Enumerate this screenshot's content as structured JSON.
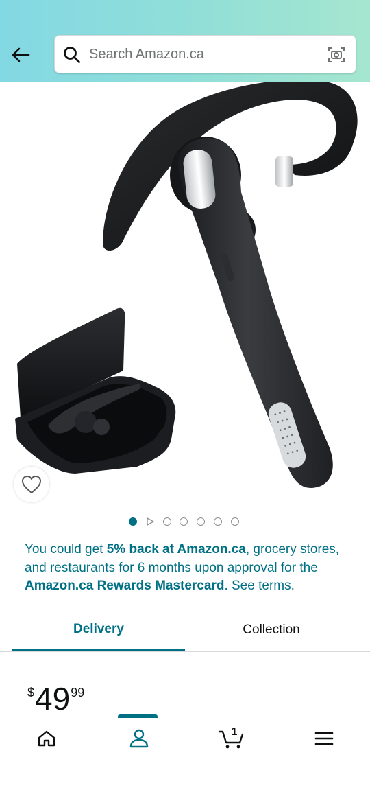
{
  "header": {
    "search_placeholder": "Search Amazon.ca"
  },
  "product": {
    "carousel_dot_count": 7,
    "active_dot_index": 0
  },
  "promo": {
    "text_1": "You could get ",
    "bold_1": "5% back at Amazon.ca",
    "text_2": ", grocery stores, and restaurants for 6 months upon approval for the ",
    "bold_2": "Amazon.ca Rewards Mastercard",
    "text_3": ". See terms."
  },
  "tabs": [
    {
      "label": "Delivery",
      "active": true
    },
    {
      "label": "Collection",
      "active": false
    }
  ],
  "price": {
    "symbol": "$",
    "whole": "49",
    "fraction": "99"
  },
  "bottom_nav": {
    "items": [
      "home-icon",
      "account-icon",
      "cart-icon",
      "menu-icon"
    ],
    "active_index": 1,
    "cart_count": "1"
  },
  "colors": {
    "accent": "#007185",
    "header_gradient_start": "#82d8e3",
    "header_gradient_end": "#a5e6cf"
  }
}
